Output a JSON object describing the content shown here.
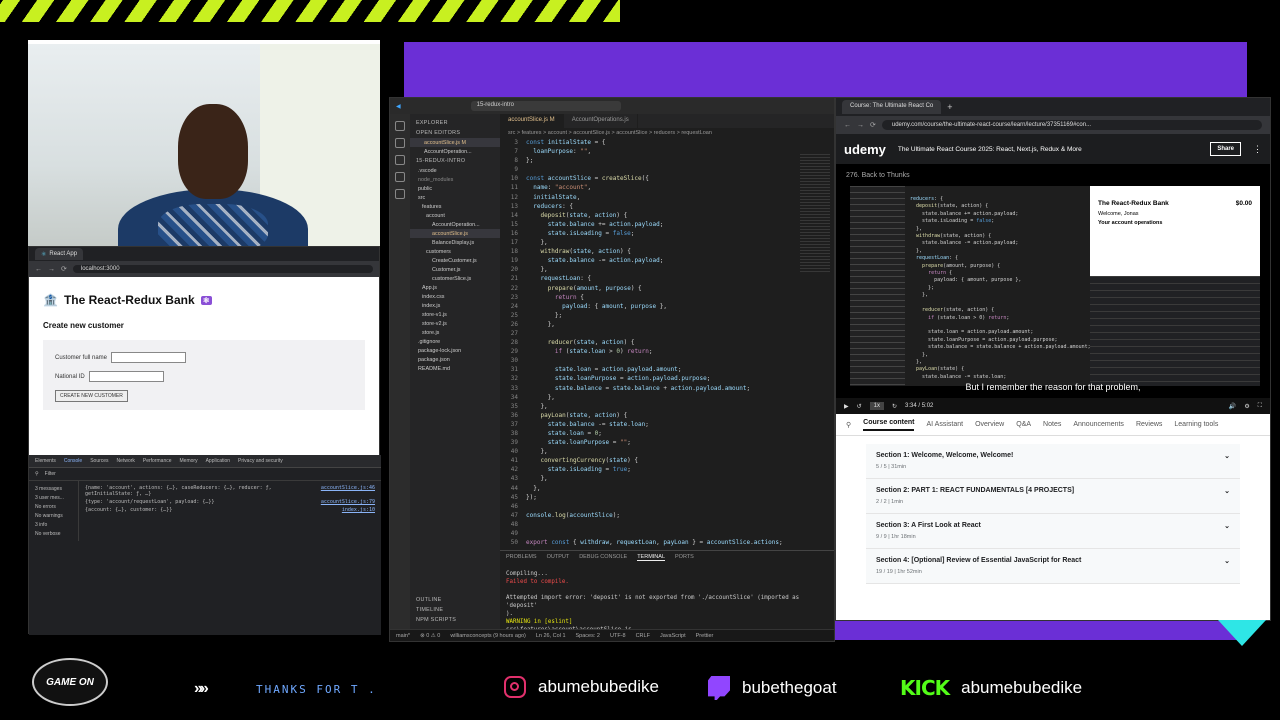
{
  "webcam": {},
  "left_browser": {
    "tab_title": "React App",
    "url": "localhost:3000",
    "app_title": "The React-Redux Bank",
    "subtitle": "Create new customer",
    "full_name_label": "Customer full name",
    "national_id_label": "National ID",
    "create_button": "CREATE NEW CUSTOMER",
    "devtools": {
      "tabs": [
        "Elements",
        "Console",
        "Sources",
        "Network",
        "Performance",
        "Memory",
        "Application",
        "Privacy and security"
      ],
      "filter_placeholder": "Filter",
      "sidebar": [
        "3 messages",
        "3 user mes...",
        "No errors",
        "No warnings",
        "3 info",
        "No verbose"
      ],
      "logs": [
        {
          "text": "{name: 'account', actions: {…}, caseReducers: {…}, reducer: ƒ, getInitialState: ƒ, …}",
          "src": "accountSlice.js:46"
        },
        {
          "text": "{type: 'account/requestLoan', payload: {…}}",
          "src": "accountSlice.js:79"
        },
        {
          "text": "{account: {…}, customer: {…}}",
          "src": "index.js:10"
        }
      ]
    }
  },
  "vscode": {
    "search": "15-redux-intro",
    "explorer_title": "EXPLORER",
    "open_editors": "OPEN EDITORS",
    "open_files": [
      "accountSlice.js M",
      "AccountOperation..."
    ],
    "project": "15-REDUX-INTRO",
    "tree": [
      ".vscode",
      "node_modules",
      "public",
      "src",
      "features",
      "account",
      "AccountOperation...",
      "accountSlice.js",
      "BalanceDisplay.js",
      "customers",
      "CreateCustomer.js",
      "Customer.js",
      "customerSlice.js",
      "App.js",
      "index.css",
      "index.js",
      "store-v1.js",
      "store-v2.js",
      "store.js",
      ".gitignore",
      "package-lock.json",
      "package.json",
      "README.md"
    ],
    "outline": [
      "OUTLINE",
      "TIMELINE",
      "NPM SCRIPTS"
    ],
    "tabs": [
      "accountSlice.js M",
      "AccountOperations.js"
    ],
    "breadcrumb": "src > features > account > accountSlice.js > accountSlice > reducers > requestLoan",
    "panel_tabs": [
      "PROBLEMS",
      "OUTPUT",
      "DEBUG CONSOLE",
      "TERMINAL",
      "PORTS"
    ],
    "terminal": [
      "Compiling...",
      "Failed to compile.",
      "",
      "Attempted import error: 'deposit' is not exported from './accountSlice' (imported as 'deposit'",
      ").",
      "WARNING in [eslint]",
      "src\\features\\account\\accountSlice.js"
    ],
    "status": {
      "branch": "main*",
      "errors": "0",
      "warnings": "0",
      "author": "williamsconcepts (9 hours ago)",
      "pos": "Ln 26, Col 1",
      "spaces": "Spaces: 2",
      "enc": "UTF-8",
      "eol": "CRLF",
      "lang": "JavaScript",
      "prettier": "Prettier"
    }
  },
  "udemy": {
    "tab_title": "Course: The Ultimate React Co",
    "url": "udemy.com/course/the-ultimate-react-course/learn/lecture/37351169#con...",
    "logo": "udemy",
    "course_title": "The Ultimate React Course 2025: React, Next.js, Redux & More",
    "share": "Share",
    "back": "276. Back to Thunks",
    "mini_app_title": "The React-Redux Bank",
    "mini_balance": "$0.00",
    "mini_welcome": "Welcome, Jonas",
    "mini_ops": "Your account operations",
    "caption": "But I remember the reason for that problem,",
    "speed": "1x",
    "time": "3:34 / 5:02",
    "nav": [
      "Course content",
      "AI Assistant",
      "Overview",
      "Q&A",
      "Notes",
      "Announcements",
      "Reviews",
      "Learning tools"
    ],
    "sections": [
      {
        "title": "Section 1: Welcome, Welcome, Welcome!",
        "meta": "5 / 5 | 31min"
      },
      {
        "title": "Section 2: PART 1: REACT FUNDAMENTALS [4 PROJECTS]",
        "meta": "2 / 2 | 1min"
      },
      {
        "title": "Section 3: A First Look at React",
        "meta": "9 / 9 | 1hr 18min"
      },
      {
        "title": "Section 4: [Optional] Review of Essential JavaScript for React",
        "meta": "19 / 19 | 1hr 52min"
      }
    ]
  },
  "bottom": {
    "badge": "GAME ON",
    "thanks": "THANKS FOR T .",
    "instagram": "abumebubedike",
    "twitch": "bubethegoat",
    "kick_logo": "KICK",
    "kick": "abumebubedike"
  }
}
